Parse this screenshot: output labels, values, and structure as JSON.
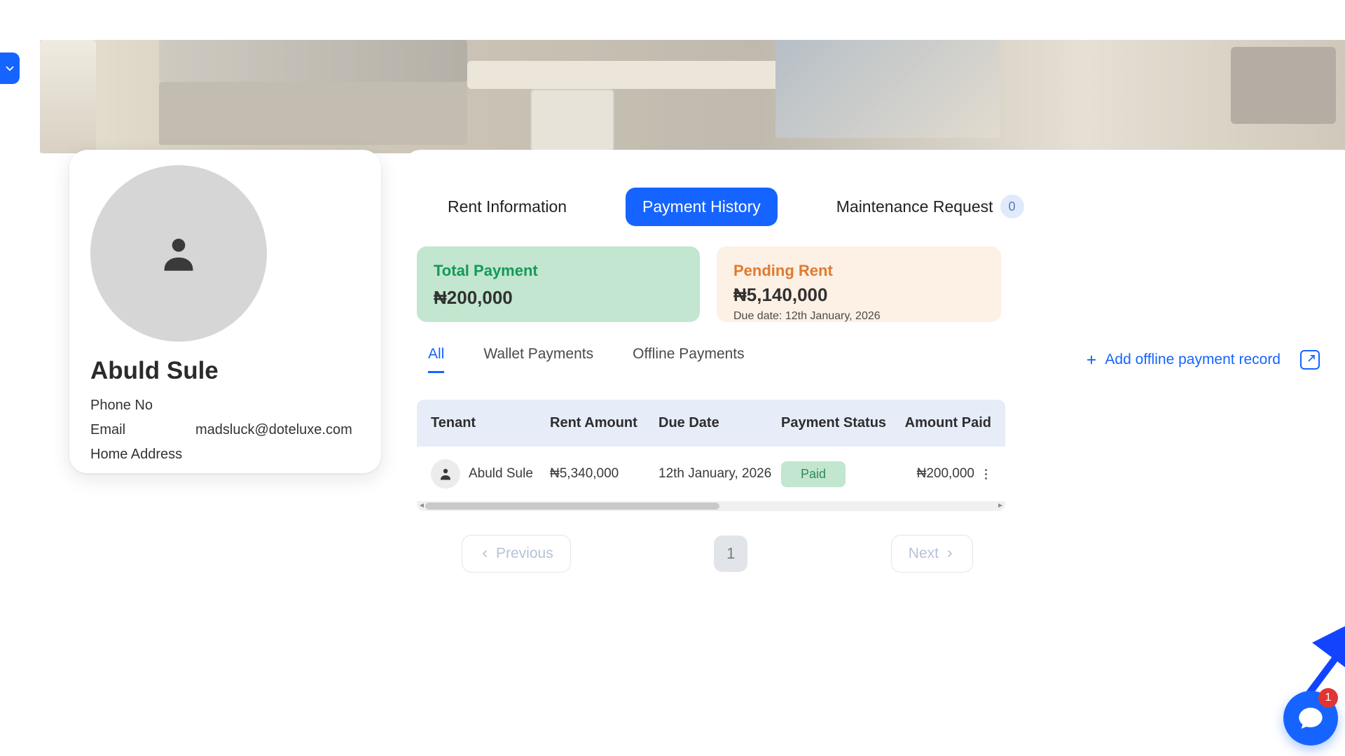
{
  "profile": {
    "name": "Abuld Sule",
    "fields": {
      "phone_label": "Phone No",
      "phone_value": "",
      "email_label": "Email",
      "email_value": "madsluck@doteluxe.com",
      "address_label": "Home Address",
      "address_value": ""
    }
  },
  "tabs": {
    "rent_info": "Rent Information",
    "payment_history": "Payment History",
    "maintenance": "Maintenance Request",
    "maintenance_count": "0",
    "active": "payment_history"
  },
  "summary": {
    "total": {
      "title": "Total Payment",
      "value": "₦200,000"
    },
    "pending": {
      "title": "Pending Rent",
      "value": "₦5,140,000",
      "due_label": "Due date: 12th January, 2026"
    }
  },
  "filters": {
    "all": "All",
    "wallet": "Wallet Payments",
    "offline": "Offline Payments",
    "add_link": "Add offline payment record"
  },
  "table": {
    "headers": {
      "tenant": "Tenant",
      "rent": "Rent Amount",
      "due": "Due Date",
      "status": "Payment Status",
      "paid": "Amount Paid"
    },
    "rows": [
      {
        "tenant": "Abuld Sule",
        "rent": "₦5,340,000",
        "due": "12th January, 2026",
        "status": "Paid",
        "paid": "₦200,000"
      }
    ]
  },
  "pagination": {
    "prev": "Previous",
    "next": "Next",
    "page": "1"
  },
  "chat": {
    "badge": "1"
  }
}
